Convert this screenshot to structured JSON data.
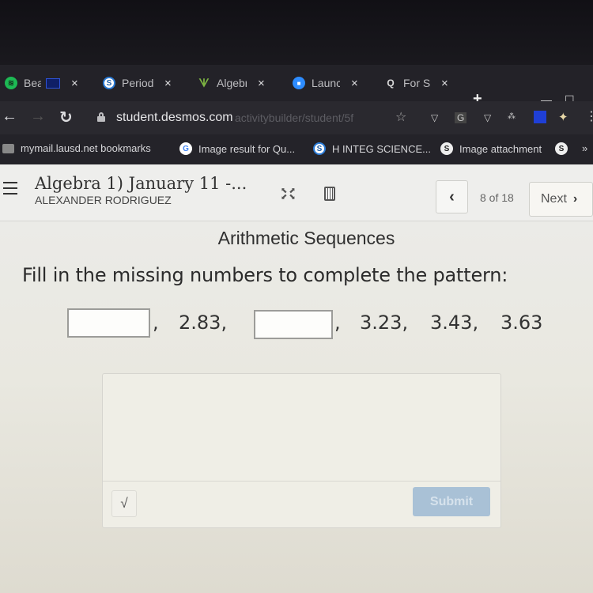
{
  "browser": {
    "tabs": [
      {
        "title": "Bea",
        "favicon": "spotify-icon",
        "color": "#1db954"
      },
      {
        "title": "Period",
        "favicon": "schoology-icon",
        "color": "#2b7bd6"
      },
      {
        "title": "Algebr",
        "favicon": "desmos-activity-icon",
        "color": "#7cb342"
      },
      {
        "title": "Launc",
        "favicon": "zoom-icon",
        "color": "#2d8cff"
      },
      {
        "title": "For St",
        "favicon": "search-icon",
        "color": "#e04040"
      }
    ],
    "close_glyph": "×",
    "new_tab_glyph": "+",
    "url_host": "student.desmos.com",
    "url_path": "activitybuilder/student/5f",
    "extension_g": "G",
    "bookmarks": [
      {
        "label": "mymail.lausd.net bookmarks",
        "icon": "folder-icon"
      },
      {
        "label": "Image result for Qu...",
        "icon": "google-icon"
      },
      {
        "label": "H INTEG SCIENCE...",
        "icon": "schoology-icon"
      },
      {
        "label": "Image attachment",
        "icon": "link-icon"
      }
    ],
    "more_bookmarks_glyph": "»"
  },
  "header": {
    "activity_title": "Algebra 1) January 11 -...",
    "student_name": "ALEXANDER RODRIGUEZ",
    "prev_glyph": "‹",
    "page_count": "8 of 18",
    "next_label": "Next",
    "next_glyph": "›"
  },
  "screen": {
    "title": "Arithmetic Sequences",
    "prompt": "Fill in the missing numbers to complete the pattern:",
    "sequence": {
      "blank1_value": "",
      "term2": "2.83,",
      "blank2_value": "",
      "term4": "3.23,",
      "term5": "3.43,",
      "term6": "3.63",
      "comma": ","
    },
    "answer_value": "",
    "math_glyph": "√",
    "submit_label": "Submit"
  }
}
